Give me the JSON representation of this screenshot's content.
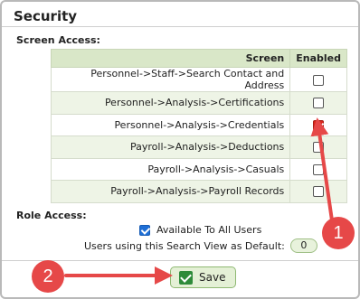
{
  "panel": {
    "title": "Security"
  },
  "screen_access": {
    "label": "Screen Access:",
    "headers": {
      "screen": "Screen",
      "enabled": "Enabled"
    },
    "rows": [
      {
        "screen": "Personnel->Staff->Search Contact and Address",
        "enabled": false
      },
      {
        "screen": "Personnel->Analysis->Certifications",
        "enabled": false
      },
      {
        "screen": "Personnel->Analysis->Credentials",
        "enabled": true
      },
      {
        "screen": "Payroll->Analysis->Deductions",
        "enabled": false
      },
      {
        "screen": "Payroll->Analysis->Casuals",
        "enabled": false
      },
      {
        "screen": "Payroll->Analysis->Payroll Records",
        "enabled": false
      }
    ]
  },
  "role_access": {
    "label": "Role Access:",
    "available_label": "Available To All Users",
    "available_checked": true,
    "default_label": "Users using this Search View as Default:",
    "default_count": "0"
  },
  "footer": {
    "save_label": "Save"
  },
  "annotations": {
    "badge_1": "1",
    "badge_2": "2",
    "color": "#e64848"
  }
}
